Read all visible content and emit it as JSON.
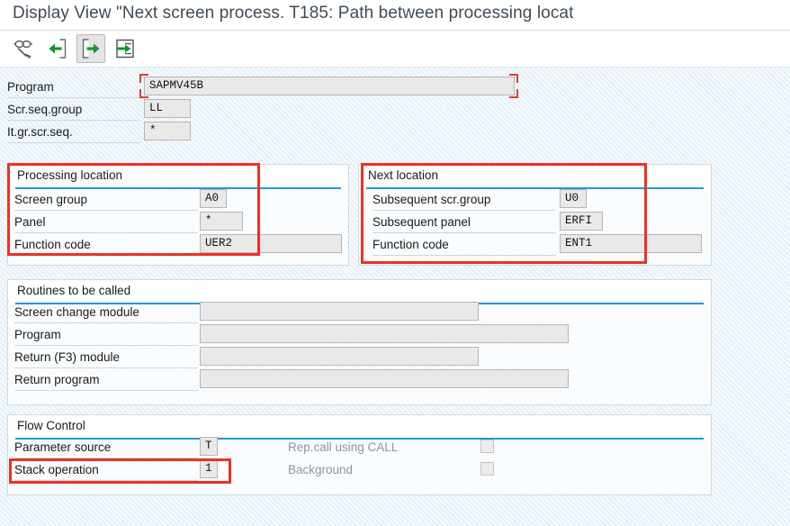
{
  "window": {
    "title": "Display View \"Next screen process. T185: Path between processing locat"
  },
  "toolbar": {
    "buttons": [
      {
        "name": "display-change-icon",
        "tooltip": "Display <-> Change"
      },
      {
        "name": "previous-entry-icon",
        "tooltip": "Previous Entry"
      },
      {
        "name": "next-entry-icon",
        "tooltip": "Next Entry"
      },
      {
        "name": "other-entry-icon",
        "tooltip": "Other Entry"
      }
    ]
  },
  "header_fields": [
    {
      "label": "Program",
      "value": "SAPMV45B",
      "highlighted": true
    },
    {
      "label": "Scr.seq.group",
      "value": "LL",
      "highlighted": false
    },
    {
      "label": "It.gr.scr.seq.",
      "value": "*",
      "highlighted": false
    }
  ],
  "processing_location": {
    "caption": "Processing location",
    "highlighted": true,
    "rows": [
      {
        "label": "Screen group",
        "value": "A0"
      },
      {
        "label": "Panel",
        "value": "*"
      },
      {
        "label": "Function code",
        "value": "UER2"
      }
    ]
  },
  "next_location": {
    "caption": "Next location",
    "highlighted": true,
    "rows": [
      {
        "label": "Subsequent scr.group",
        "value": "U0"
      },
      {
        "label": "Subsequent panel",
        "value": "ERFI"
      },
      {
        "label": "Function code",
        "value": "ENT1"
      }
    ]
  },
  "routines": {
    "caption": "Routines to be called",
    "rows": [
      {
        "label": "Screen change module",
        "value": ""
      },
      {
        "label": "Program",
        "value": ""
      },
      {
        "label": "Return (F3) module",
        "value": ""
      },
      {
        "label": "Return program",
        "value": ""
      }
    ]
  },
  "flow_control": {
    "caption": "Flow Control",
    "rows": [
      {
        "label": "Parameter source",
        "value": "T",
        "highlighted": false
      },
      {
        "label": "Stack operation",
        "value": "1",
        "highlighted": true
      }
    ],
    "checkboxes": [
      {
        "label": "Rep.call using CALL",
        "checked": false,
        "disabled": true
      },
      {
        "label": "Background",
        "checked": false,
        "disabled": true
      }
    ]
  },
  "colors": {
    "annotation_red": "#ee3124",
    "panel_rule_blue": "#1e9bd7",
    "field_bg": "#e9e9e9",
    "title_text": "#3f4b57"
  }
}
